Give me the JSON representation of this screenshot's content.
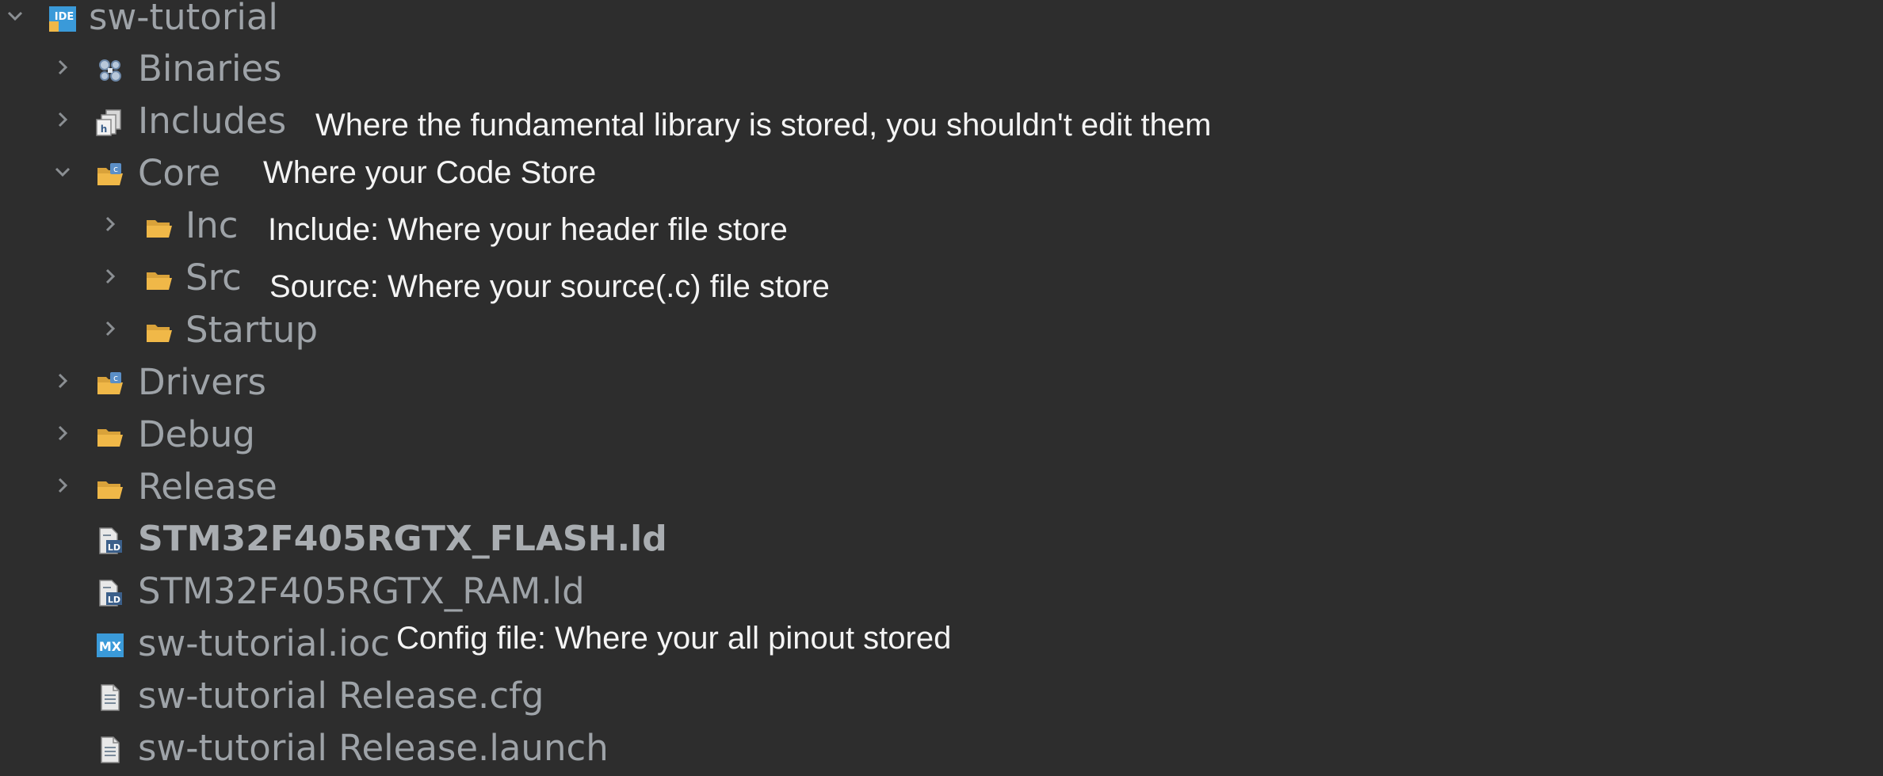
{
  "tree": {
    "root": {
      "label": "sw-tutorial",
      "icon": "ide-project-icon",
      "expanded": true
    },
    "binaries": {
      "label": "Binaries",
      "icon": "binaries-icon"
    },
    "includes": {
      "label": "Includes",
      "icon": "includes-icon"
    },
    "core": {
      "label": "Core",
      "icon": "source-folder-icon",
      "expanded": true
    },
    "inc": {
      "label": "Inc",
      "icon": "folder-icon"
    },
    "src": {
      "label": "Src",
      "icon": "folder-icon"
    },
    "startup": {
      "label": "Startup",
      "icon": "folder-icon"
    },
    "drivers": {
      "label": "Drivers",
      "icon": "source-folder-icon"
    },
    "debug": {
      "label": "Debug",
      "icon": "folder-icon"
    },
    "release": {
      "label": "Release",
      "icon": "folder-icon"
    },
    "flash_ld": {
      "label": "STM32F405RGTX_FLASH.ld",
      "icon": "linker-file-icon"
    },
    "ram_ld": {
      "label": "STM32F405RGTX_RAM.ld",
      "icon": "linker-file-icon"
    },
    "ioc": {
      "label": "sw-tutorial.ioc",
      "icon": "mx-icon"
    },
    "cfg": {
      "label": "sw-tutorial Release.cfg",
      "icon": "file-icon"
    },
    "launch": {
      "label": "sw-tutorial Release.launch",
      "icon": "file-icon"
    }
  },
  "annotations": {
    "includes": "Where the fundamental library is stored, you shouldn't edit them",
    "core": "Where your Code Store",
    "inc": "Include: Where your header file store",
    "src": "Source: Where your source(.c) file store",
    "ioc": "Config file: Where your all pinout stored"
  },
  "colors": {
    "background": "#2d2d2d",
    "tree_text": "#9ea3a8",
    "annotation_text": "#f4f4f4",
    "folder": "#f0b848",
    "mx_blue": "#3a9ad9"
  }
}
